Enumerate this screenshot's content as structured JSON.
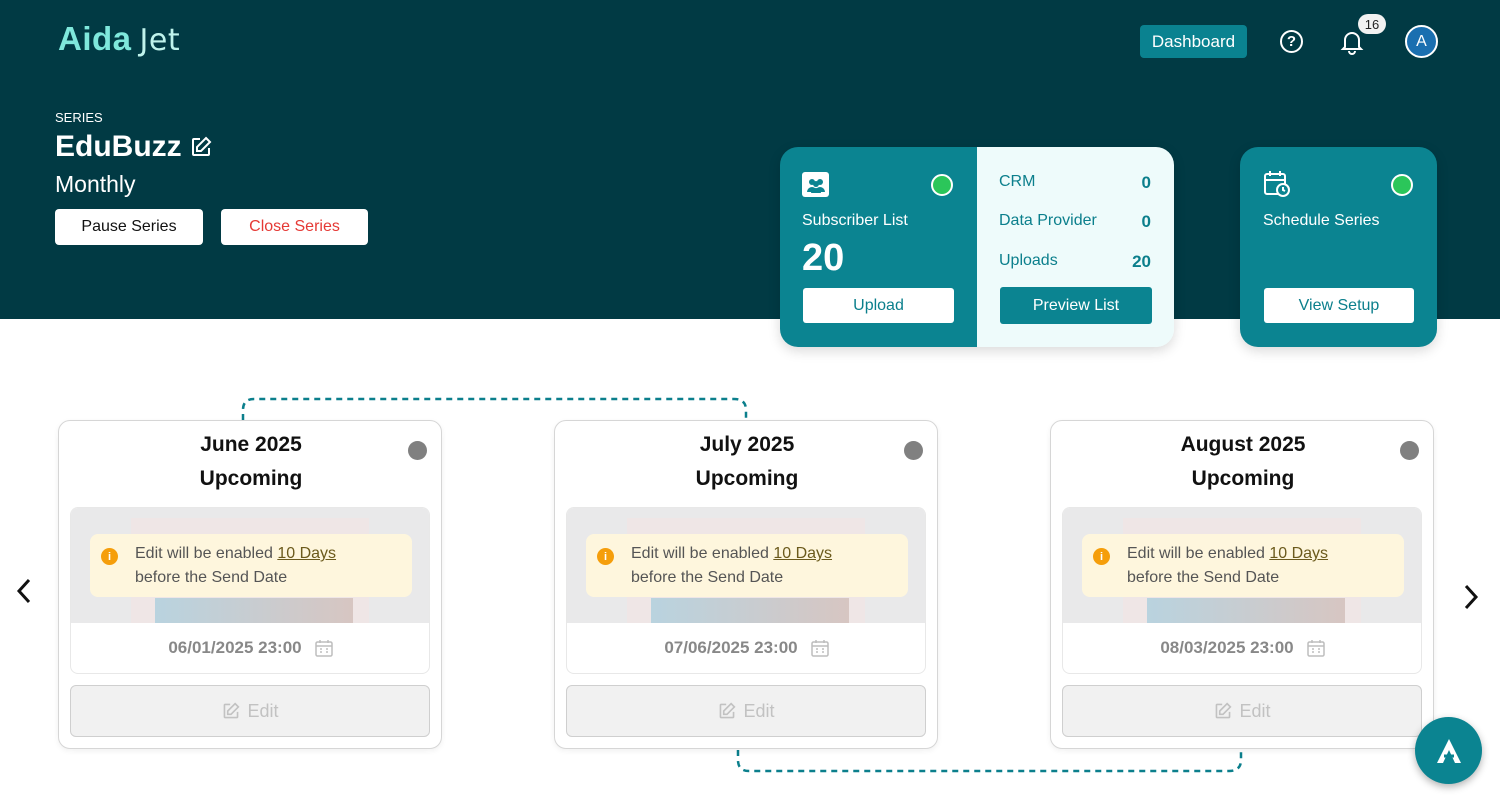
{
  "header": {
    "logo_primary": "Aida",
    "logo_secondary": "Jet",
    "dashboard_label": "Dashboard",
    "notification_count": "16",
    "avatar_initial": "A"
  },
  "series": {
    "label": "SERIES",
    "name": "EduBuzz",
    "frequency": "Monthly",
    "pause_label": "Pause Series",
    "close_label": "Close Series"
  },
  "subscriber_card": {
    "title": "Subscriber List",
    "count": "20",
    "upload_label": "Upload",
    "stats": [
      {
        "label": "CRM",
        "value": "0"
      },
      {
        "label": "Data Provider",
        "value": "0"
      },
      {
        "label": "Uploads",
        "value": "20"
      }
    ],
    "preview_label": "Preview List"
  },
  "schedule_card": {
    "title": "Schedule Series",
    "setup_label": "View Setup"
  },
  "months": [
    {
      "title": "June 2025",
      "status": "Upcoming",
      "notice_prefix": "Edit will be enabled",
      "notice_link": "10 Days",
      "notice_suffix": "before the Send Date",
      "date": "06/01/2025 23:00",
      "edit_label": "Edit"
    },
    {
      "title": "July 2025",
      "status": "Upcoming",
      "notice_prefix": "Edit will be enabled",
      "notice_link": "10 Days",
      "notice_suffix": "before the Send Date",
      "date": "07/06/2025 23:00",
      "edit_label": "Edit"
    },
    {
      "title": "August 2025",
      "status": "Upcoming",
      "notice_prefix": "Edit will be enabled",
      "notice_link": "10 Days",
      "notice_suffix": "before the Send Date",
      "date": "08/03/2025 23:00",
      "edit_label": "Edit"
    }
  ],
  "colors": {
    "header_bg": "#013a44",
    "accent": "#0b8491",
    "status_active": "#2bc65a",
    "status_pending": "#808080",
    "danger": "#e53935"
  },
  "icons": {
    "prev": "chevron-left-icon",
    "next": "chevron-right-icon",
    "help": "help-icon",
    "bell": "bell-icon",
    "edit": "edit-icon",
    "calendar": "calendar-icon",
    "info": "info-icon"
  }
}
